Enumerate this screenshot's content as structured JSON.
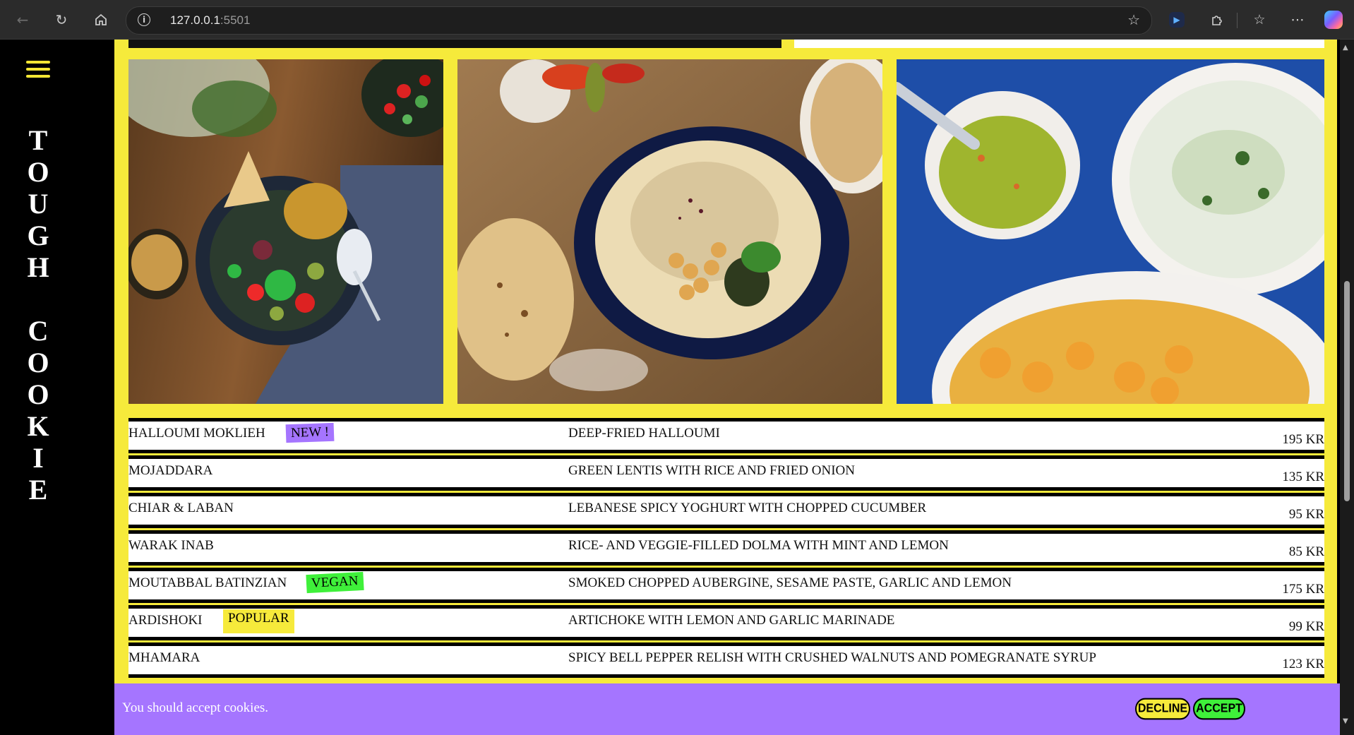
{
  "browser": {
    "url_host": "127.0.0.1",
    "url_port": ":5501"
  },
  "site": {
    "brand_letters": [
      "T",
      "O",
      "U",
      "G",
      "H",
      "",
      "C",
      "O",
      "O",
      "K",
      "I",
      "E"
    ]
  },
  "menu": {
    "items": [
      {
        "name": "HALLOUMI MOKLIEH",
        "tag": "NEW !",
        "tag_color": "#a575ff",
        "description": "DEEP-FRIED HALLOUMI",
        "price": "195 KR"
      },
      {
        "name": "MOJADDARA",
        "tag": "",
        "tag_color": "",
        "description": "GREEN LENTIS WITH RICE AND FRIED ONION",
        "price": "135 KR"
      },
      {
        "name": "CHIAR & LABAN",
        "tag": "",
        "tag_color": "",
        "description": "LEBANESE SPICY YOGHURT WITH CHOPPED CUCUMBER",
        "price": "95 KR"
      },
      {
        "name": "WARAK INAB",
        "tag": "",
        "tag_color": "",
        "description": "RICE- AND VEGGIE-FILLED DOLMA WITH MINT AND LEMON",
        "price": "85 KR"
      },
      {
        "name": "MOUTABBAL BATINZIAN",
        "tag": "VEGAN",
        "tag_color": "#3ff03a",
        "description": "SMOKED CHOPPED AUBERGINE, SESAME PASTE, GARLIC AND LEMON",
        "price": "175 KR"
      },
      {
        "name": "ARDISHOKI",
        "tag": "POPULAR",
        "tag_color": "#f6ea3b",
        "description": "ARTICHOKE WITH LEMON AND GARLIC MARINADE",
        "price": "99 KR"
      },
      {
        "name": "MHAMARA",
        "tag": "",
        "tag_color": "",
        "description": "SPICY BELL PEPPER RELISH WITH CRUSHED WALNUTS AND POMEGRANATE SYRUP",
        "price": "123 KR"
      }
    ]
  },
  "cookie": {
    "message": "You should accept cookies.",
    "decline_label": "DECLINE",
    "accept_label": "ACCEPT"
  },
  "colors": {
    "accent_yellow": "#f6ea3b",
    "accent_purple": "#a575ff",
    "accent_green": "#3ff03a"
  }
}
